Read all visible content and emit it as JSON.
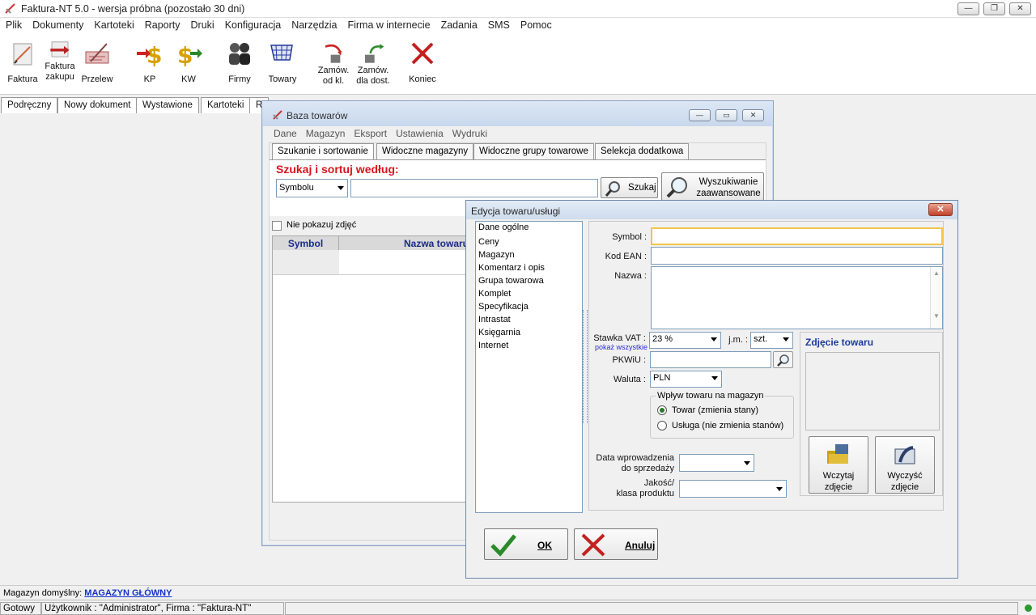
{
  "app": {
    "title": "Faktura-NT 5.0 - wersja próbna (pozostało 30 dni)"
  },
  "menu": [
    "Plik",
    "Dokumenty",
    "Kartoteki",
    "Raporty",
    "Druki",
    "Konfiguracja",
    "Narzędzia",
    "Firma w internecie",
    "Zadania",
    "SMS",
    "Pomoc"
  ],
  "toolbar": {
    "faktura": "Faktura",
    "faktura_zakupu_1": "Faktura",
    "faktura_zakupu_2": "zakupu",
    "przelew": "Przelew",
    "kp": "KP",
    "kw": "KW",
    "firmy": "Firmy",
    "towary": "Towary",
    "zamow_kl_1": "Zamów.",
    "zamow_kl_2": "od kl.",
    "zamow_dost_1": "Zamów.",
    "zamow_dost_2": "dla dost.",
    "koniec": "Koniec"
  },
  "tabs": [
    "Podręczny",
    "Nowy dokument",
    "Wystawione",
    "Kartoteki",
    "R"
  ],
  "baza": {
    "title": "Baza towarów",
    "menu": [
      "Dane",
      "Magazyn",
      "Eksport",
      "Ustawienia",
      "Wydruki"
    ],
    "tabs": [
      "Szukanie i sortowanie",
      "Widoczne magazyny",
      "Widoczne grupy towarowe",
      "Selekcja dodatkowa"
    ],
    "search_heading": "Szukaj i sortuj według:",
    "sort_field": "Symbolu",
    "search_value": "",
    "search_button": "Szukaj",
    "adv_1": "Wyszukiwanie",
    "adv_2": "zaawansowane",
    "no_photos": "Nie pokazuj zdjęć",
    "col_symbol": "Symbol",
    "col_name": "Nazwa towaru"
  },
  "edycja": {
    "title": "Edycja towaru/usługi",
    "close": "✕",
    "nav": [
      "Dane ogólne",
      "Ceny",
      "Magazyn",
      "Komentarz i opis",
      "Grupa towarowa",
      "Komplet",
      "Specyfikacja",
      "Intrastat",
      "Księgarnia",
      "Internet"
    ],
    "symbol_label": "Symbol :",
    "ean_label": "Kod EAN :",
    "name_label": "Nazwa :",
    "vat_label": "Stawka VAT :",
    "vat_all": "pokaż wszystkie",
    "vat_value": "23 %",
    "jm_label": "j.m. :",
    "jm_value": "szt.",
    "pkwiu_label": "PKWiU :",
    "currency_label": "Waluta :",
    "currency_value": "PLN",
    "impact_group": "Wpływ towaru na magazyn",
    "radio_towar": "Towar (zmienia stany)",
    "radio_usluga": "Usługa (nie zmienia stanów)",
    "date_label_1": "Data wprowadzenia",
    "date_label_2": "do sprzedaży",
    "quality_label_1": "Jakość/",
    "quality_label_2": "klasa produktu",
    "photo_title": "Zdjęcie towaru",
    "load_1": "Wczytaj",
    "load_2": "zdjęcie",
    "clear_1": "Wyczyść",
    "clear_2": "zdjęcie",
    "ok": "OK",
    "cancel": "Anuluj"
  },
  "status": {
    "warehouse_label": "Magazyn domyślny:",
    "warehouse_value": "MAGAZYN GŁÓWNY",
    "ready": "Gotowy",
    "user": "Użytkownik : \"Administrator\", Firma : \"Faktura-NT\""
  },
  "colors": {
    "heading_red": "#d9141c",
    "accent_blue": "#2b2bd0",
    "link_blue": "#1432c8"
  }
}
